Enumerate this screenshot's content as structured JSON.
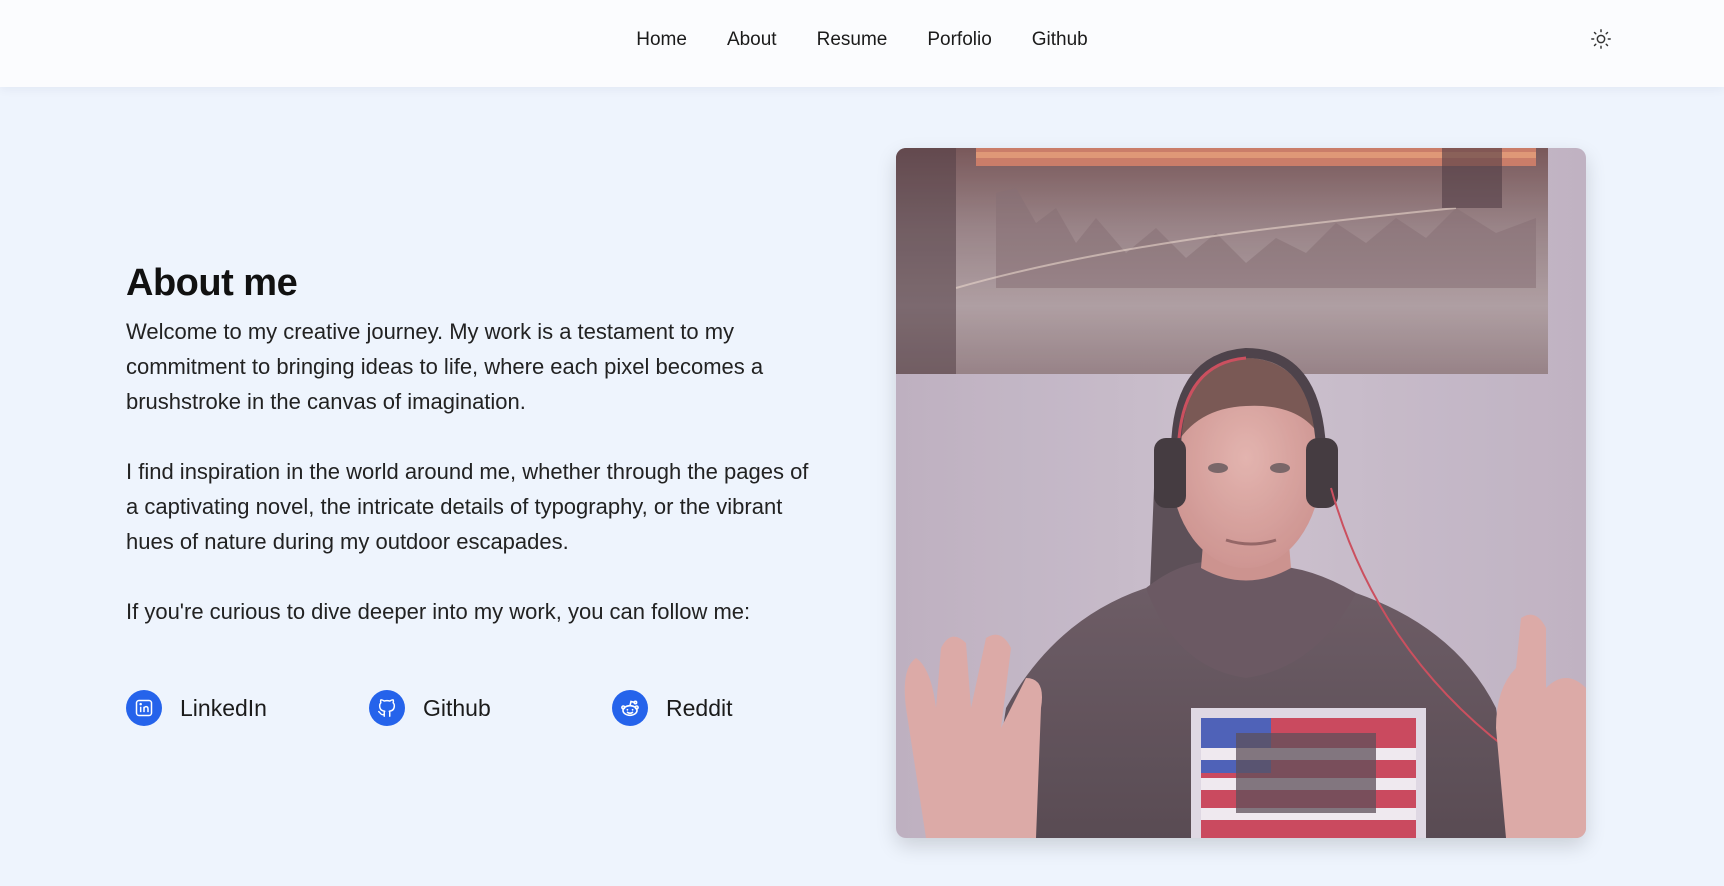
{
  "nav": {
    "items": [
      "Home",
      "About",
      "Resume",
      "Porfolio",
      "Github"
    ]
  },
  "theme_toggle_icon": "sun-icon",
  "about": {
    "title": "About me",
    "paragraph1": "Welcome to my creative journey. My work is a testament to my commitment to bringing ideas to life, where each pixel becomes a brushstroke in the canvas of imagination.",
    "paragraph2": "I find inspiration in the world around me, whether through the pages of a captivating novel, the intricate details of typography, or the vibrant hues of nature during my outdoor escapades.",
    "paragraph3": "If you're curious to dive deeper into my work, you can follow me:"
  },
  "socials": [
    {
      "label": "LinkedIn",
      "icon": "linkedin-icon"
    },
    {
      "label": "Github",
      "icon": "github-icon"
    },
    {
      "label": "Reddit",
      "icon": "reddit-icon"
    }
  ],
  "colors": {
    "accent": "#2563eb",
    "background": "#eef4fd",
    "topbar": "#fbfcfe"
  }
}
